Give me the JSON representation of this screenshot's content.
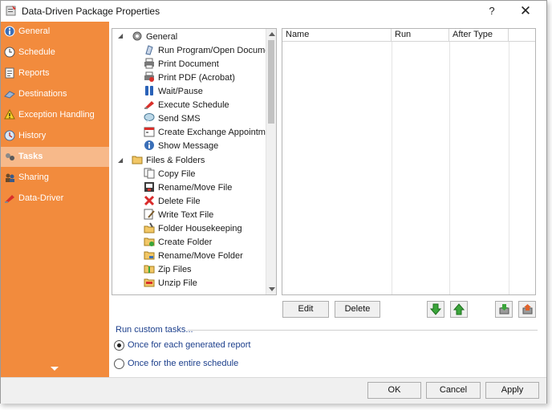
{
  "window": {
    "title": "Data-Driven Package Properties",
    "help_label": "?",
    "close_label": "✕"
  },
  "sidebar": {
    "items": [
      {
        "label": "General",
        "icon": "info-icon"
      },
      {
        "label": "Schedule",
        "icon": "clock-icon"
      },
      {
        "label": "Reports",
        "icon": "report-icon"
      },
      {
        "label": "Destinations",
        "icon": "destinations-icon"
      },
      {
        "label": "Exception Handling",
        "icon": "warning-icon"
      },
      {
        "label": "History",
        "icon": "history-icon"
      },
      {
        "label": "Tasks",
        "icon": "tasks-icon",
        "selected": true
      },
      {
        "label": "Sharing",
        "icon": "sharing-icon"
      },
      {
        "label": "Data-Driver",
        "icon": "data-driver-icon"
      }
    ]
  },
  "tree": {
    "groups": [
      {
        "label": "General",
        "icon": "gear-icon",
        "items": [
          {
            "label": "Run Program/Open Document",
            "icon": "run-program-icon"
          },
          {
            "label": "Print Document",
            "icon": "printer-icon"
          },
          {
            "label": "Print PDF (Acrobat)",
            "icon": "print-pdf-icon"
          },
          {
            "label": "Wait/Pause",
            "icon": "pause-icon"
          },
          {
            "label": "Execute Schedule",
            "icon": "execute-schedule-icon"
          },
          {
            "label": "Send SMS",
            "icon": "sms-icon"
          },
          {
            "label": "Create Exchange Appointment",
            "icon": "appointment-icon"
          },
          {
            "label": "Show Message",
            "icon": "info-icon"
          }
        ]
      },
      {
        "label": "Files & Folders",
        "icon": "folder-icon",
        "items": [
          {
            "label": "Copy File",
            "icon": "copy-file-icon"
          },
          {
            "label": "Rename/Move File",
            "icon": "rename-file-icon"
          },
          {
            "label": "Delete File",
            "icon": "delete-icon"
          },
          {
            "label": "Write Text File",
            "icon": "write-text-icon"
          },
          {
            "label": "Folder Housekeeping",
            "icon": "housekeeping-icon"
          },
          {
            "label": "Create Folder",
            "icon": "create-folder-icon"
          },
          {
            "label": "Rename/Move Folder",
            "icon": "rename-folder-icon"
          },
          {
            "label": "Zip Files",
            "icon": "zip-icon"
          },
          {
            "label": "Unzip File",
            "icon": "unzip-icon"
          }
        ]
      }
    ]
  },
  "grid": {
    "columns": [
      "Name",
      "Run",
      "After Type"
    ],
    "rows": []
  },
  "buttons": {
    "edit": "Edit",
    "delete": "Delete",
    "ok": "OK",
    "cancel": "Cancel",
    "apply": "Apply"
  },
  "custom_tasks": {
    "label": "Run custom tasks...",
    "options": [
      {
        "label": "Once for each generated report",
        "checked": true
      },
      {
        "label": "Once for the entire schedule",
        "checked": false
      }
    ]
  },
  "colors": {
    "sidebar": "#f28b3d",
    "sidebar_selected": "#f7b98a",
    "link_text": "#1c3f8c"
  }
}
